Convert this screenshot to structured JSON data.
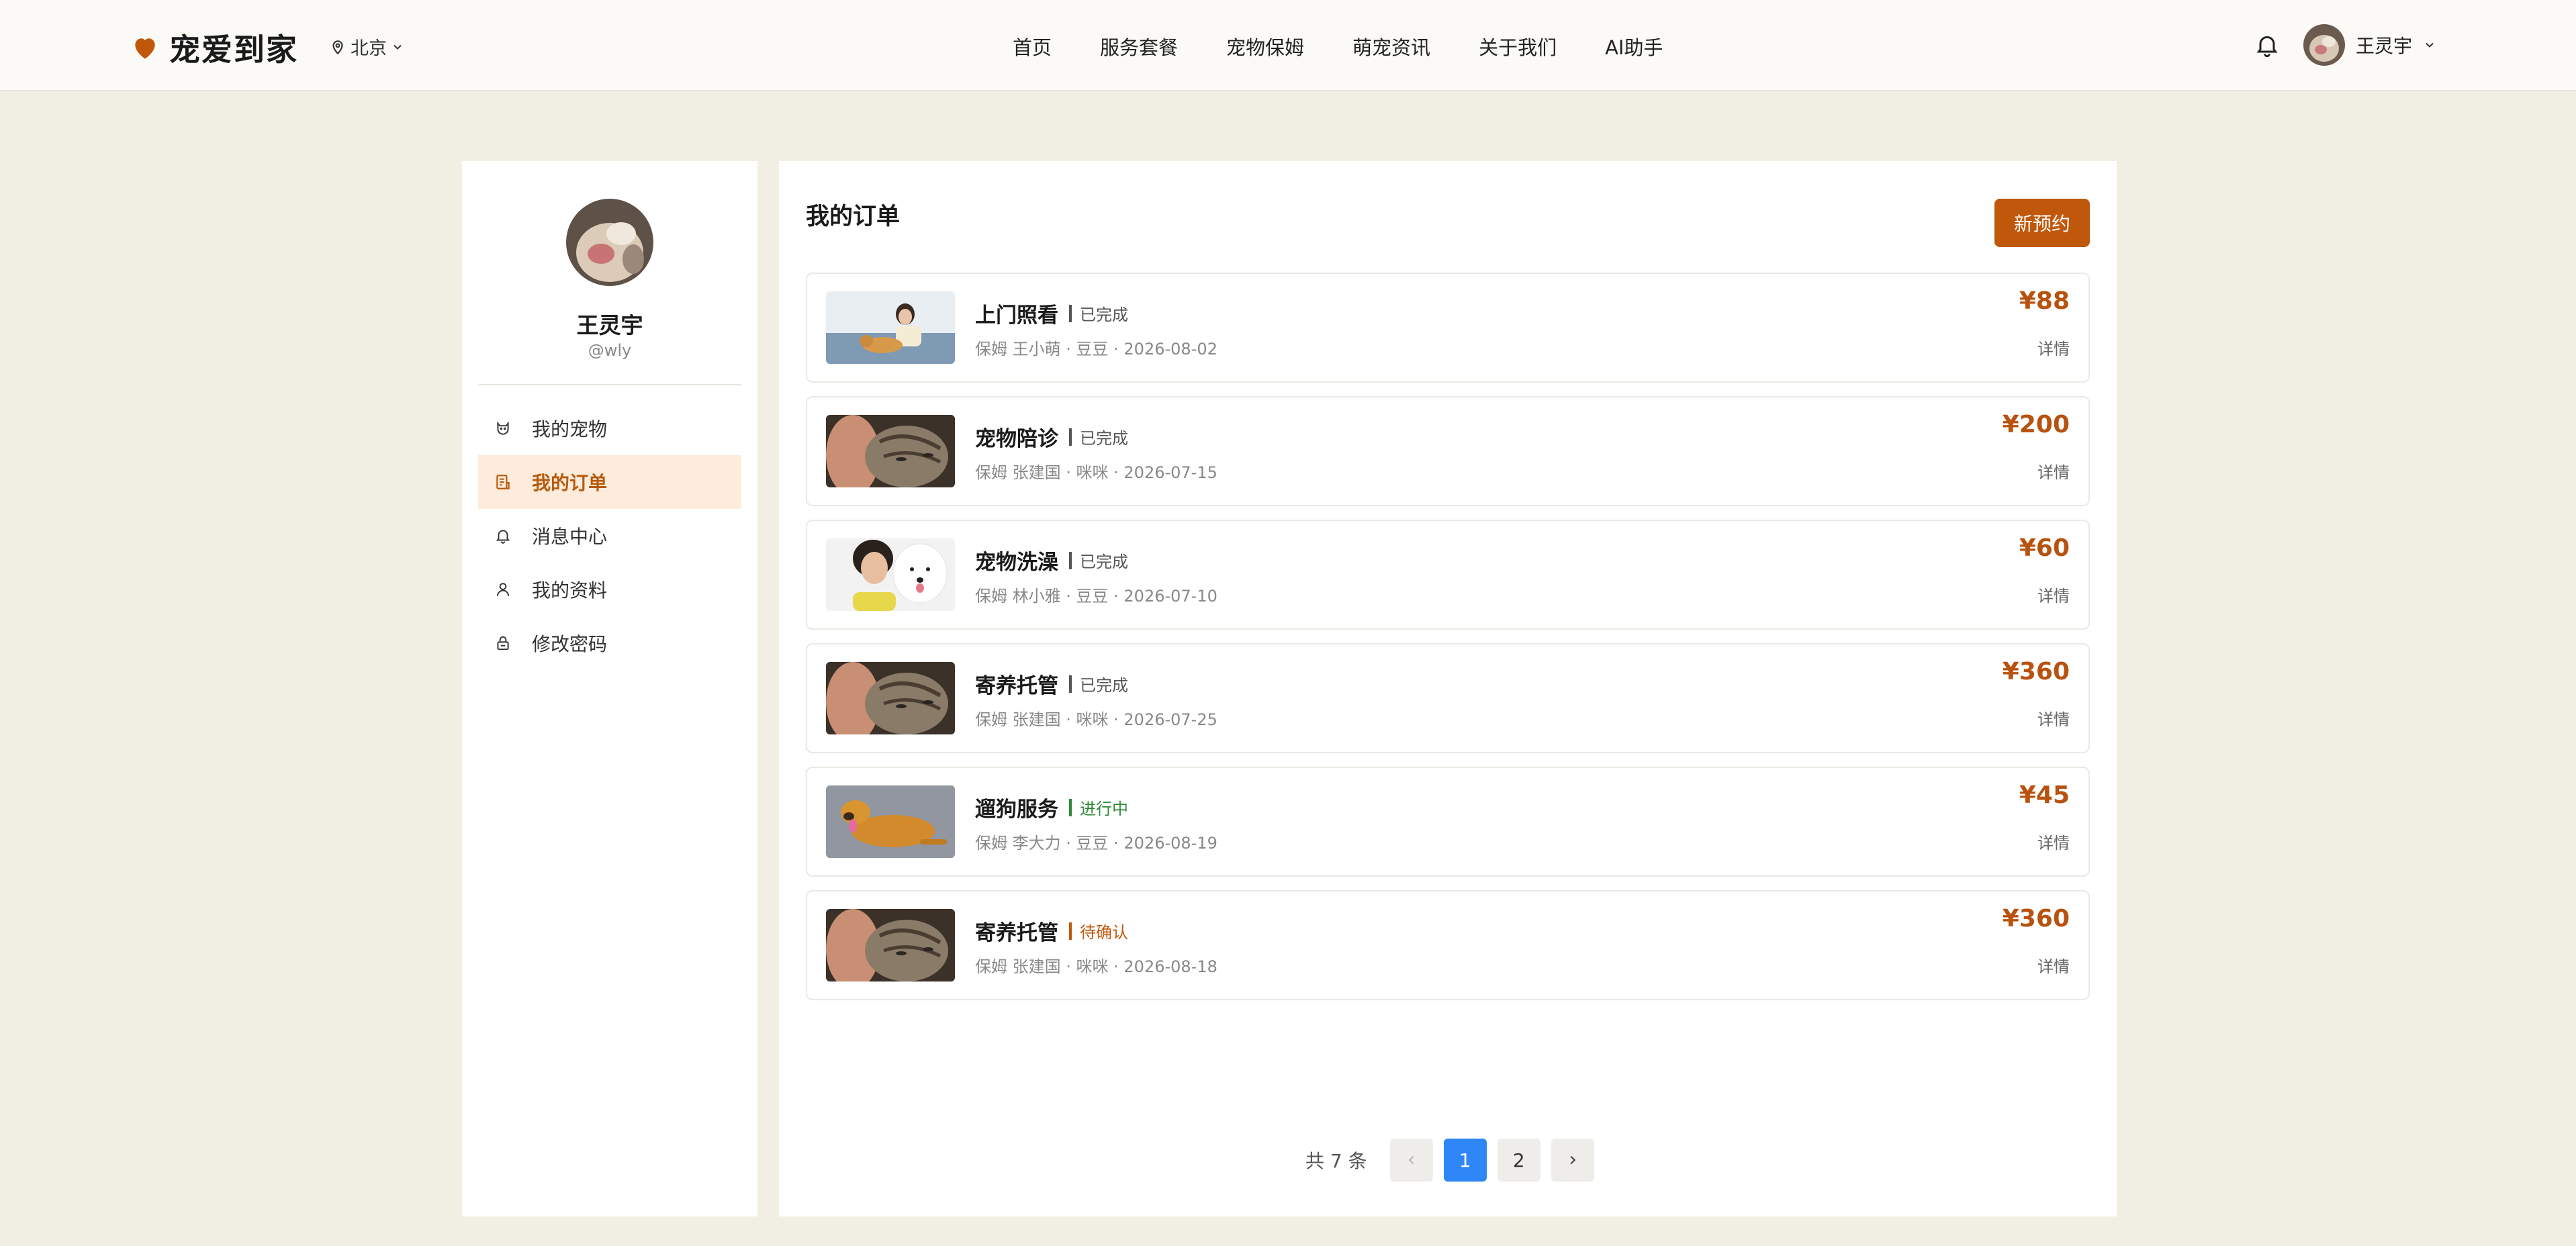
{
  "header": {
    "brand": "宠爱到家",
    "city": "北京",
    "nav": [
      "首页",
      "服务套餐",
      "宠物保姆",
      "萌宠资讯",
      "关于我们",
      "AI助手"
    ],
    "user_name": "王灵宇"
  },
  "sidebar": {
    "name": "王灵宇",
    "handle": "@wly",
    "items": [
      {
        "label": "我的宠物",
        "icon": "pet-icon"
      },
      {
        "label": "我的订单",
        "icon": "orders-icon"
      },
      {
        "label": "消息中心",
        "icon": "bell-icon"
      },
      {
        "label": "我的资料",
        "icon": "user-icon"
      },
      {
        "label": "修改密码",
        "icon": "lock-icon"
      }
    ],
    "active_index": 1
  },
  "main": {
    "title": "我的订单",
    "new_button": "新预约",
    "orders": [
      {
        "service": "上门照看",
        "status": "已完成",
        "status_color": "#555555",
        "meta": "保姆 王小萌 · 豆豆 · 2026-08-02",
        "price": "¥88",
        "detail": "详情",
        "image": "woman-with-dog"
      },
      {
        "service": "宠物陪诊",
        "status": "已完成",
        "status_color": "#555555",
        "meta": "保姆 张建国 · 咪咪 · 2026-07-15",
        "price": "¥200",
        "detail": "详情",
        "image": "tabby-cat"
      },
      {
        "service": "宠物洗澡",
        "status": "已完成",
        "status_color": "#555555",
        "meta": "保姆 林小雅 · 豆豆 · 2026-07-10",
        "price": "¥60",
        "detail": "详情",
        "image": "woman-with-samoyed"
      },
      {
        "service": "寄养托管",
        "status": "已完成",
        "status_color": "#555555",
        "meta": "保姆 张建国 · 咪咪 · 2026-07-25",
        "price": "¥360",
        "detail": "详情",
        "image": "tabby-cat"
      },
      {
        "service": "遛狗服务",
        "status": "进行中",
        "status_color": "#2f8a3a",
        "meta": "保姆 李大力 · 豆豆 · 2026-08-19",
        "price": "¥45",
        "detail": "详情",
        "image": "golden-dog"
      },
      {
        "service": "寄养托管",
        "status": "待确认",
        "status_color": "#c0580c",
        "meta": "保姆 张建国 · 咪咪 · 2026-08-18",
        "price": "¥360",
        "detail": "详情",
        "image": "tabby-cat"
      }
    ]
  },
  "pagination": {
    "total_label": "共 7 条",
    "pages": [
      "1",
      "2"
    ],
    "current": "1"
  },
  "colors": {
    "accent": "#c0580c",
    "price": "#b8520f",
    "page_active": "#2f86f6",
    "background": "#f1efe4"
  }
}
